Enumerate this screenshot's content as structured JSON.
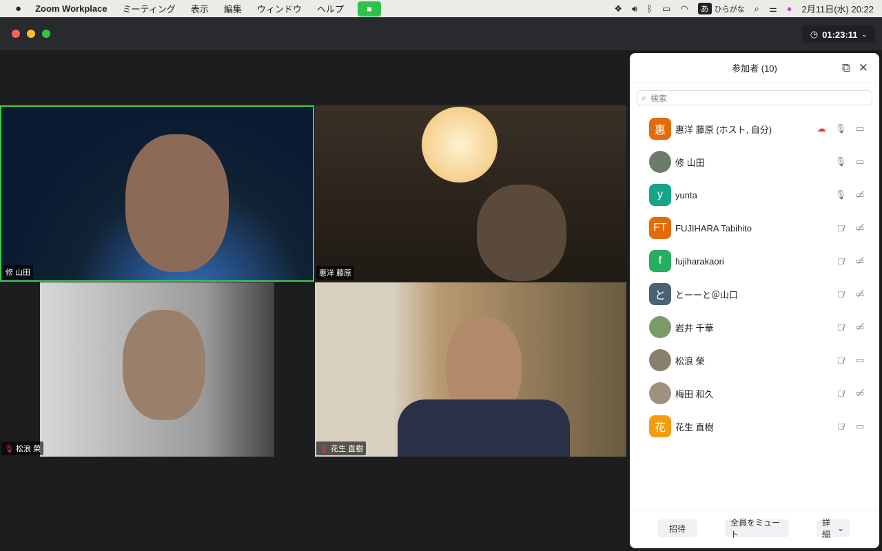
{
  "menubar": {
    "app": "Zoom Workplace",
    "items": [
      "ミーティング",
      "表示",
      "編集",
      "ウィンドウ",
      "ヘルプ"
    ],
    "ime": "あ",
    "ime_mode": "ひらがな",
    "datetime": "2月11日(水)  20:22"
  },
  "meeting": {
    "timer": "01:23:11"
  },
  "tiles": [
    {
      "name": "修 山田",
      "muted": false,
      "active": true
    },
    {
      "name": "惠洋 藤原",
      "muted": false,
      "active": false
    },
    {
      "name": "松浪 榮",
      "muted": true,
      "active": false
    },
    {
      "name": "花生 直樹",
      "muted": true,
      "active": false
    }
  ],
  "panel": {
    "title": "参加者 (10)",
    "search_placeholder": "検索",
    "participants": [
      {
        "initial": "惠",
        "color": "#e36c0a",
        "name": "惠洋 藤原 (ホスト, 自分)",
        "mic": "on",
        "video": "on",
        "recording": true
      },
      {
        "initial": "",
        "color": "#6b7d6a",
        "name": "修 山田",
        "mic": "on",
        "video": "on"
      },
      {
        "initial": "y",
        "color": "#17a589",
        "name": "yunta",
        "mic": "on",
        "video": "off"
      },
      {
        "initial": "FT",
        "color": "#e36c0a",
        "name": "FUJIHARA Tabihito",
        "mic": "muted",
        "video": "off"
      },
      {
        "initial": "f",
        "color": "#27ae60",
        "name": "fujiharakaori",
        "mic": "muted",
        "video": "off"
      },
      {
        "initial": "と",
        "color": "#4a6274",
        "name": "とーーと＠山口",
        "mic": "muted",
        "video": "off"
      },
      {
        "initial": "",
        "color": "#7a9a6a",
        "name": "岩井 千華",
        "mic": "muted",
        "video": "off"
      },
      {
        "initial": "",
        "color": "#8a8070",
        "name": "松浪 榮",
        "mic": "muted",
        "video": "on"
      },
      {
        "initial": "",
        "color": "#a09080",
        "name": "梅田 和久",
        "mic": "muted",
        "video": "off"
      },
      {
        "initial": "花",
        "color": "#f39c12",
        "name": "花生 直樹",
        "mic": "muted",
        "video": "on"
      }
    ],
    "invite": "招待",
    "mute_all": "全員をミュート",
    "more": "詳細"
  }
}
